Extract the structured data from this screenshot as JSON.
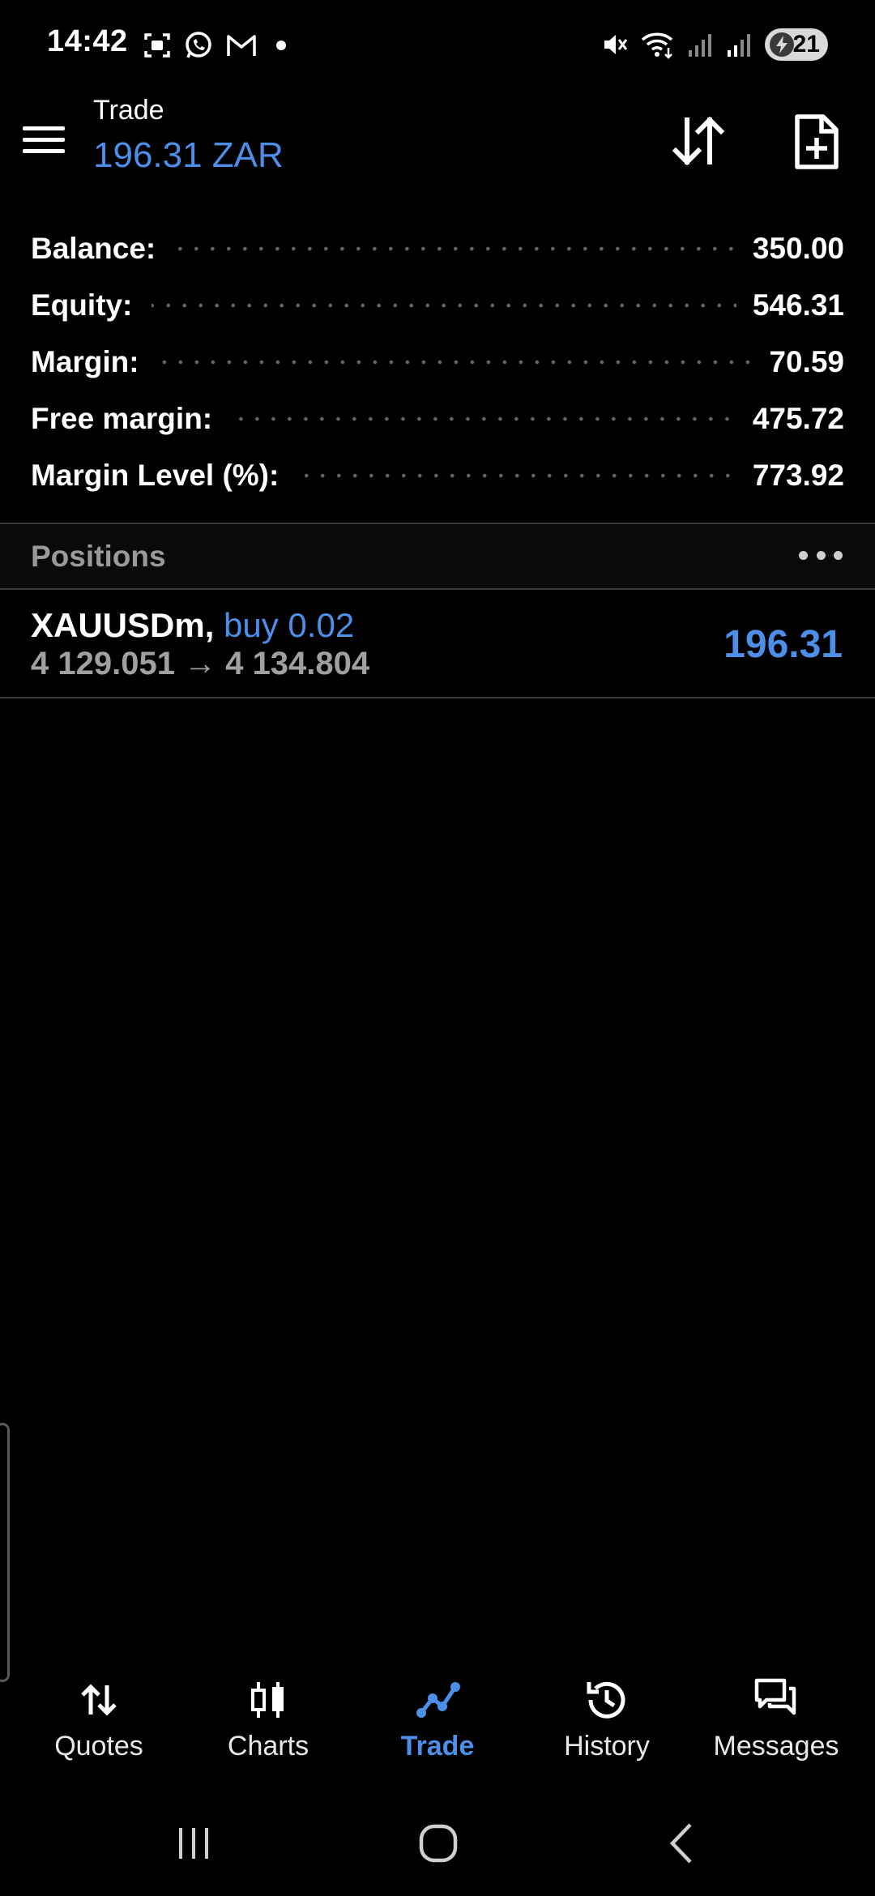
{
  "status_bar": {
    "time": "14:42",
    "left_icons": [
      "screenshot-icon",
      "whatsapp-icon",
      "gmail-icon",
      "dot-icon"
    ],
    "right_icons": [
      "mute-icon",
      "wifi-icon",
      "signal-icon",
      "signal-icon"
    ],
    "battery_level": "21"
  },
  "header": {
    "title": "Trade",
    "balance": "196.31 ZAR"
  },
  "summary": {
    "rows": [
      {
        "label": "Balance:",
        "value": "350.00"
      },
      {
        "label": "Equity:",
        "value": "546.31"
      },
      {
        "label": "Margin:",
        "value": "70.59"
      },
      {
        "label": "Free margin:",
        "value": "475.72"
      },
      {
        "label": "Margin Level (%):",
        "value": "773.92"
      }
    ]
  },
  "positions": {
    "title": "Positions",
    "items": [
      {
        "symbol": "XAUUSDm,",
        "type": "buy 0.02",
        "open_price": "4 129.051",
        "arrow": "→",
        "current_price": "4 134.804",
        "profit": "196.31"
      }
    ]
  },
  "bottom_nav": {
    "items": [
      {
        "label": "Quotes",
        "icon": "quotes-icon"
      },
      {
        "label": "Charts",
        "icon": "charts-icon"
      },
      {
        "label": "Trade",
        "icon": "trade-icon",
        "active": true
      },
      {
        "label": "History",
        "icon": "history-icon"
      },
      {
        "label": "Messages",
        "icon": "messages-icon"
      }
    ]
  },
  "colors": {
    "accent": "#4d8ee8",
    "background": "#000000",
    "muted_text": "#9a9a9a"
  }
}
